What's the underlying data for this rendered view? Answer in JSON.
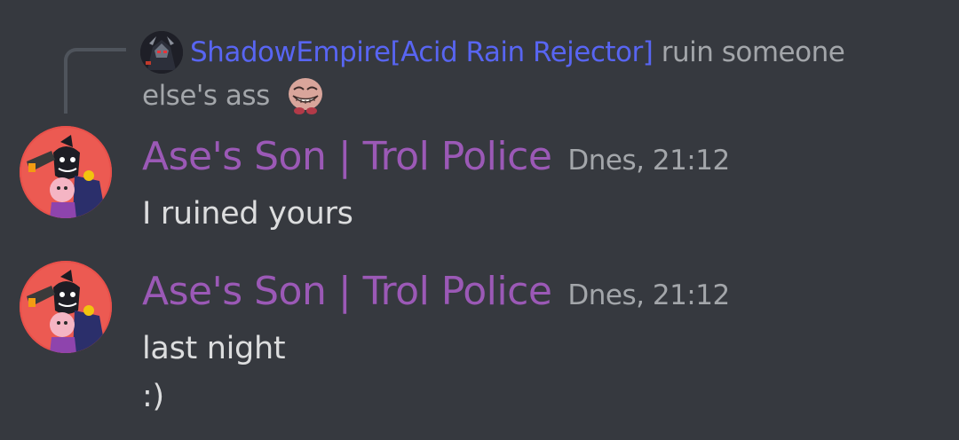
{
  "reply": {
    "author": "ShadowEmpire[Acid Rain Rejector]",
    "text_line1": "ruin someone",
    "text_line2": "else's ass",
    "emoji": "trollface-emoji"
  },
  "messages": [
    {
      "author": "Ase's Son | Trol Police",
      "timestamp": "Dnes, 21:12",
      "lines": [
        "I ruined yours"
      ]
    },
    {
      "author": "Ase's Son | Trol Police",
      "timestamp": "Dnes, 21:12",
      "lines": [
        "last night",
        ":)"
      ]
    }
  ],
  "colors": {
    "background": "#36393f",
    "reply_author": "#5865f2",
    "author": "#9b59b6",
    "muted_text": "#a3a6aa",
    "message_text": "#dcddde",
    "reply_spine": "#4f545c"
  }
}
